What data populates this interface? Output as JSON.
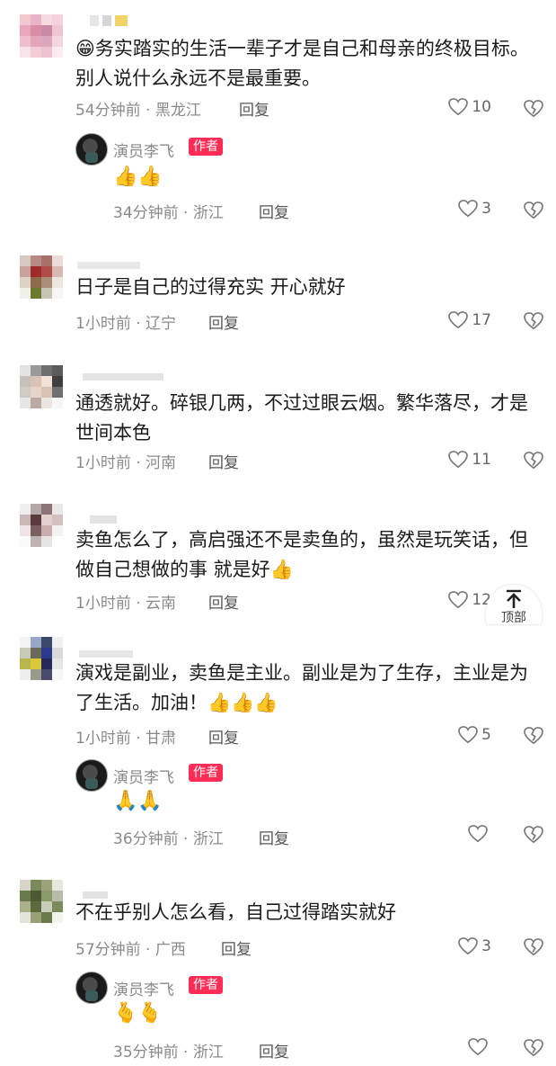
{
  "comments": [
    {
      "text": "😁务实踏实的生活一辈子才是自己和母亲的终极目标。别人说什么永远不是最重要。",
      "meta": "54分钟前 · 黑龙江",
      "reply": "回复",
      "likes": "10",
      "sub": {
        "name": "演员李飞",
        "tag": "作者",
        "emoji": "👍👍",
        "meta": "34分钟前 · 浙江",
        "reply": "回复",
        "likes": "3"
      }
    },
    {
      "text": "日子是自己的过得充实 开心就好",
      "meta": "1小时前 · 辽宁",
      "reply": "回复",
      "likes": "17"
    },
    {
      "text": "通透就好。碎银几两，不过过眼云烟。繁华落尽，才是世间本色",
      "meta": "1小时前 · 河南",
      "reply": "回复",
      "likes": "11"
    },
    {
      "text": "卖鱼怎么了，高启强还不是卖鱼的，虽然是玩笑话，但做自己想做的事 就是好👍",
      "meta": "1小时前 · 云南",
      "reply": "回复",
      "likes": "12"
    },
    {
      "text": "演戏是副业，卖鱼是主业。副业是为了生存，主业是为了生活。加油！👍👍👍",
      "meta": "1小时前 · 甘肃",
      "reply": "回复",
      "likes": "5",
      "sub": {
        "name": "演员李飞",
        "tag": "作者",
        "emoji": "🙏🙏",
        "meta": "36分钟前 · 浙江",
        "reply": "回复",
        "likes": ""
      }
    },
    {
      "text": "不在乎别人怎么看，自己过得踏实就好",
      "meta": "57分钟前 · 广西",
      "reply": "回复",
      "likes": "3",
      "sub": {
        "name": "演员李飞",
        "tag": "作者",
        "emoji": "🫰🫰",
        "meta": "35分钟前 · 浙江",
        "reply": "回复",
        "likes": ""
      }
    }
  ],
  "top_button": {
    "label": "顶部"
  },
  "colors": {
    "author_tag": "#ff2c55",
    "meta_text": "#8a8a8a"
  }
}
